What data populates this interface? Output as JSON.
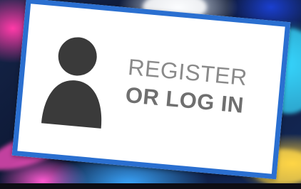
{
  "card": {
    "line1": "REGISTER",
    "line2": "OR LOG IN",
    "icon": "user-silhouette-icon",
    "border_color": "#2a6fd0",
    "icon_color": "#3a3a3a"
  }
}
